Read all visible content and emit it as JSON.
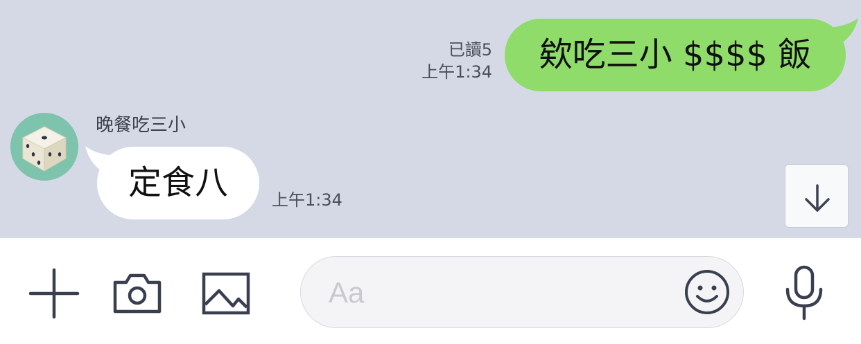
{
  "chat": {
    "outgoing": {
      "text": "欸吃三小 $$$$ 飯",
      "read_status": "已讀5",
      "time": "上午1:34",
      "bubble_color": "#8fdc6a"
    },
    "incoming": {
      "sender": "晚餐吃三小",
      "text": "定食八",
      "time": "上午1:34"
    },
    "background_color": "#d5d9e6"
  },
  "input_bar": {
    "placeholder": "Aa",
    "icons": [
      "plus-icon",
      "camera-icon",
      "image-icon",
      "emoji-icon",
      "microphone-icon"
    ]
  },
  "scroll_button": {
    "icon": "arrow-down-icon"
  }
}
